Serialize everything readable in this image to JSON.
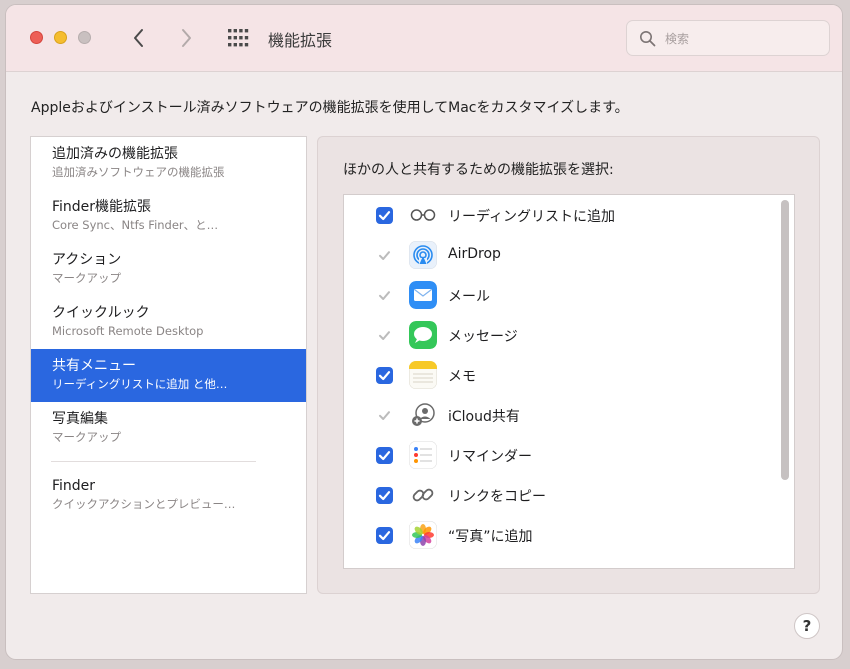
{
  "window": {
    "title": "機能拡張",
    "search_placeholder": "検索"
  },
  "description": "Appleおよびインストール済みソフトウェアの機能拡張を使用してMacをカスタマイズします。",
  "sidebar": {
    "items": [
      {
        "label": "追加済みの機能拡張",
        "sub": "追加済みソフトウェアの機能拡張"
      },
      {
        "label": "Finder機能拡張",
        "sub": "Core Sync、Ntfs Finder、と…"
      },
      {
        "label": "アクション",
        "sub": "マークアップ"
      },
      {
        "label": "クイックルック",
        "sub": "Microsoft Remote Desktop"
      },
      {
        "label": "共有メニュー",
        "sub": "リーディングリストに追加 と他…",
        "selected": true
      },
      {
        "label": "写真編集",
        "sub": "マークアップ"
      },
      {
        "label": "Finder",
        "sub": "クイックアクションとプレビュー…"
      }
    ]
  },
  "panel": {
    "title": "ほかの人と共有するための機能拡張を選択:",
    "rows": [
      {
        "label": "リーディングリストに追加",
        "checked": true,
        "locked": false,
        "icon": "glasses-icon"
      },
      {
        "label": "AirDrop",
        "checked": true,
        "locked": true,
        "icon": "airdrop-icon"
      },
      {
        "label": "メール",
        "checked": true,
        "locked": true,
        "icon": "mail-icon"
      },
      {
        "label": "メッセージ",
        "checked": true,
        "locked": true,
        "icon": "messages-icon"
      },
      {
        "label": "メモ",
        "checked": true,
        "locked": false,
        "icon": "notes-icon"
      },
      {
        "label": "iCloud共有",
        "checked": true,
        "locked": true,
        "icon": "icloud-share-icon"
      },
      {
        "label": "リマインダー",
        "checked": true,
        "locked": false,
        "icon": "reminders-icon"
      },
      {
        "label": "リンクをコピー",
        "checked": true,
        "locked": false,
        "icon": "link-icon"
      },
      {
        "label": "“写真”に追加",
        "checked": true,
        "locked": false,
        "icon": "photos-icon"
      }
    ]
  },
  "help_label": "?",
  "colors": {
    "accent": "#2a67e0",
    "titlebar": "#f5e4e6",
    "window_bg": "#f1ebeb"
  }
}
